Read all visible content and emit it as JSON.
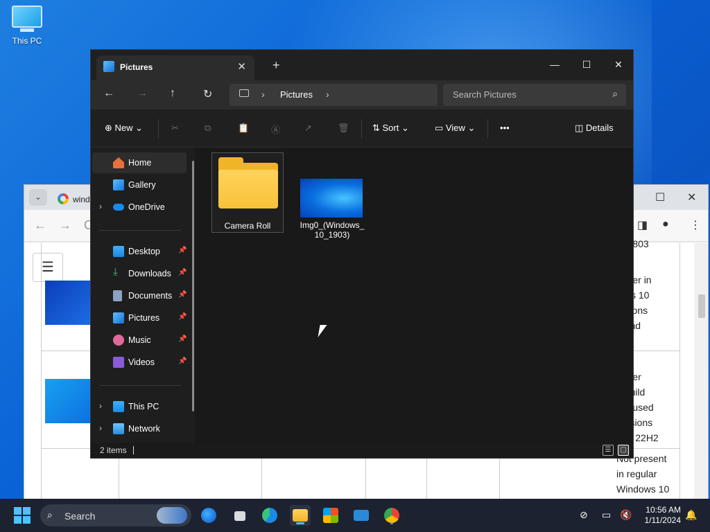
{
  "desktop": {
    "icons": [
      {
        "label": "This PC",
        "icon": "this-pc-icon"
      }
    ]
  },
  "background_window": {
    "tab_title": "wind",
    "table_cells": [
      "to 1803",
      "ault\npaper in\nlows 10\nersions\n3 and\n9",
      "ault\npaper\ne build\n82, used\n versions\n3 to 22H2",
      "Not present\nin regular\nWindows 10"
    ]
  },
  "explorer": {
    "tab_title": "Pictures",
    "new_tab_label": "+",
    "caption": {
      "minimize": "—",
      "maximize": "☐",
      "close": "✕"
    },
    "breadcrumb": [
      "Pictures"
    ],
    "search_placeholder": "Search Pictures",
    "commands": {
      "new": "New",
      "sort": "Sort",
      "view": "View",
      "more": "•••",
      "details": "Details"
    },
    "nav": [
      {
        "label": "Home",
        "icon": "home-icon",
        "selected": true
      },
      {
        "label": "Gallery",
        "icon": "gallery-icon"
      },
      {
        "label": "OneDrive",
        "icon": "onedrive-icon",
        "expandable": true
      },
      {
        "label": "Desktop",
        "icon": "desktop-icon",
        "pinned": true
      },
      {
        "label": "Downloads",
        "icon": "downloads-icon",
        "pinned": true
      },
      {
        "label": "Documents",
        "icon": "documents-icon",
        "pinned": true
      },
      {
        "label": "Pictures",
        "icon": "pictures-icon",
        "pinned": true
      },
      {
        "label": "Music",
        "icon": "music-icon",
        "pinned": true
      },
      {
        "label": "Videos",
        "icon": "videos-icon",
        "pinned": true
      },
      {
        "label": "This PC",
        "icon": "this-pc-icon",
        "expandable": true
      },
      {
        "label": "Network",
        "icon": "network-icon",
        "expandable": true
      }
    ],
    "files": [
      {
        "name": "Camera Roll",
        "type": "folder",
        "selected": true
      },
      {
        "name": "Img0_(Windows_\n10_1903)",
        "type": "image"
      }
    ],
    "status": "2 items"
  },
  "taskbar": {
    "search_placeholder": "Search",
    "apps": [
      "edge-dev-icon",
      "task-view-icon",
      "edge-icon",
      "file-explorer-icon",
      "store-icon",
      "mail-icon",
      "chrome-icon"
    ],
    "time": "10:56 AM",
    "date": "1/11/2024"
  },
  "colors": {
    "accent": "#4cc2ff",
    "explorer_bg": "#191919",
    "folder": "#f7c23a",
    "desktop": "#0a63d6"
  }
}
